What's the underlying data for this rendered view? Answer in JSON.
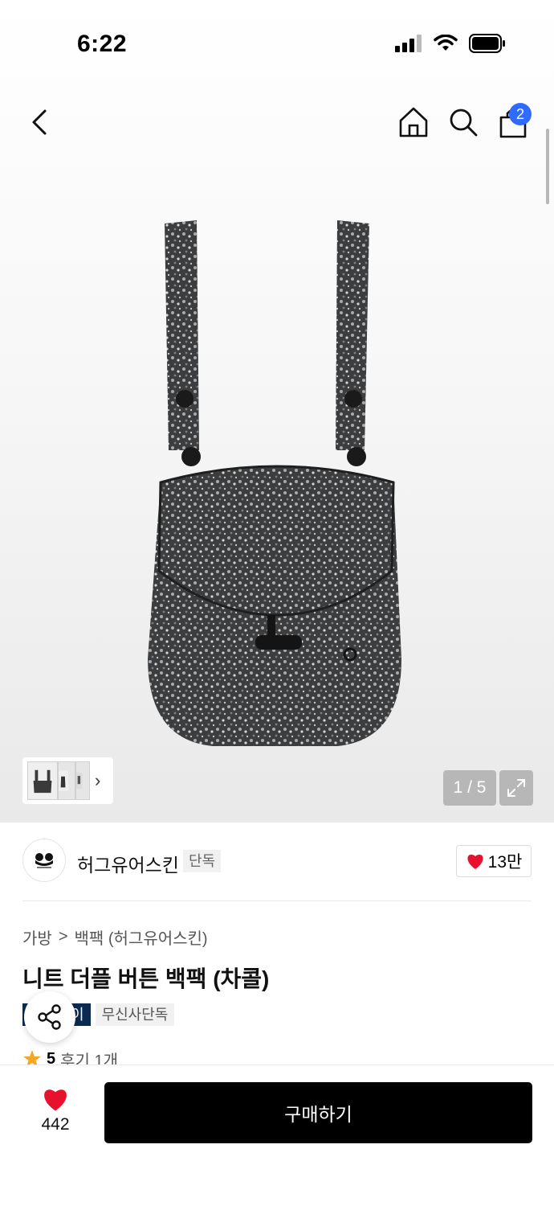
{
  "status": {
    "time": "6:22"
  },
  "nav": {
    "cart_count": "2"
  },
  "gallery": {
    "page_counter": "1 / 5",
    "current_page": 1,
    "total_pages": 5
  },
  "brand": {
    "name": "허그유어스킨",
    "tag": "단독",
    "likes": "13만"
  },
  "breadcrumb": {
    "category": "가방",
    "separator": ">",
    "subcategory": "백팩 (허그유어스킨)"
  },
  "product": {
    "title": "니트 더플 버튼 백팩 (차콜)",
    "badges": [
      "이",
      "무신사단독"
    ],
    "rating": "5",
    "reviews": "후기 1개"
  },
  "bottom": {
    "like_count": "442",
    "buy_label": "구매하기"
  },
  "colors": {
    "accent_blue": "#2f6bff",
    "heart_red": "#e8112d",
    "badge_navy": "#0c2a4f",
    "star": "#f5a623"
  }
}
